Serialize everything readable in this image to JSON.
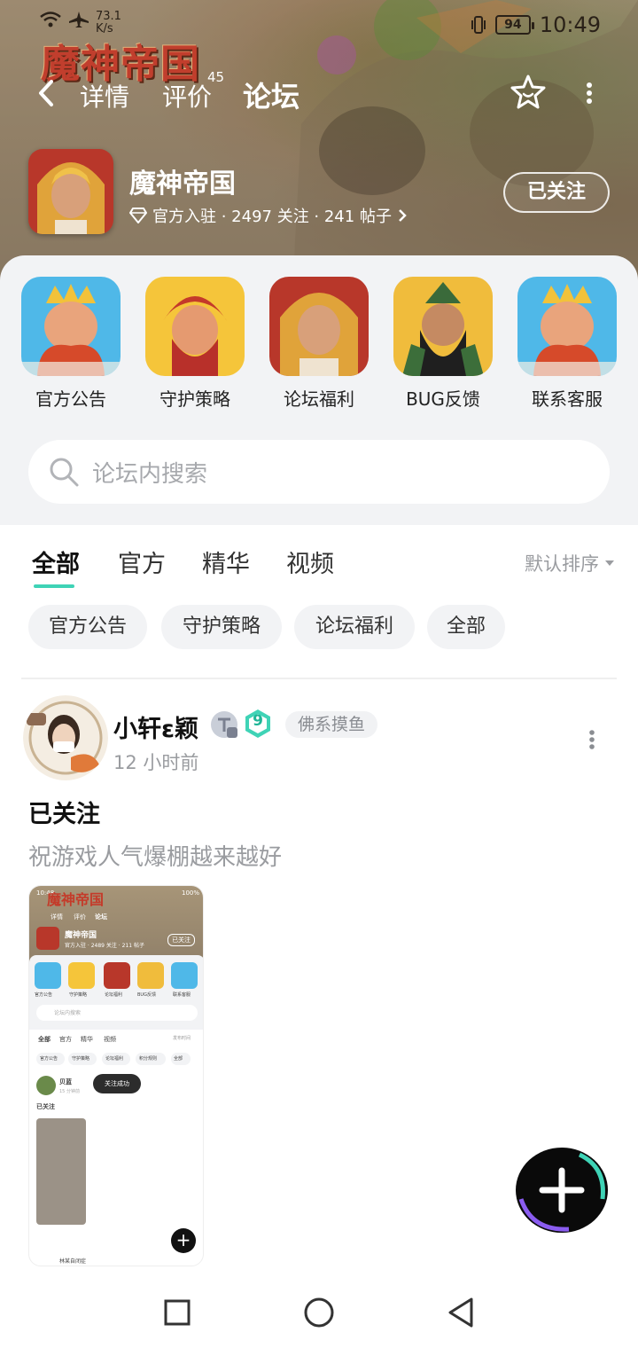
{
  "status_bar": {
    "net_speed_value": "73.1",
    "net_speed_unit": "K/s",
    "battery": "94",
    "time": "10:49"
  },
  "header": {
    "logo_text": "魔神帝国",
    "tabs": [
      {
        "label": "详情",
        "active": false
      },
      {
        "label": "评价",
        "active": false,
        "count": "45"
      },
      {
        "label": "论坛",
        "active": true
      }
    ],
    "accent_color": "#3fd3b6"
  },
  "game": {
    "name": "魔神帝国",
    "meta": "官方入驻 · 2497 关注 · 241 帖子",
    "follow_label": "已关注"
  },
  "shortcuts": [
    {
      "label": "官方公告",
      "icon": "king-portrait-icon"
    },
    {
      "label": "守护策略",
      "icon": "warrior-portrait-icon"
    },
    {
      "label": "论坛福利",
      "icon": "emperor-portrait-icon"
    },
    {
      "label": "BUG反馈",
      "icon": "general-portrait-icon"
    },
    {
      "label": "联系客服",
      "icon": "king-portrait-icon"
    }
  ],
  "search": {
    "placeholder": "论坛内搜索"
  },
  "filter_tabs": [
    {
      "label": "全部",
      "active": true
    },
    {
      "label": "官方",
      "active": false
    },
    {
      "label": "精华",
      "active": false
    },
    {
      "label": "视频",
      "active": false
    }
  ],
  "sort_label": "默认排序",
  "chips": [
    "官方公告",
    "守护策略",
    "论坛福利",
    "全部"
  ],
  "post": {
    "author": "小轩ɛ颖",
    "level": "9",
    "tag": "佛系摸鱼",
    "time": "12 小时前",
    "title": "已关注",
    "body": "祝游戏人气爆棚越来越好",
    "screenshot": {
      "status_time": "10:48",
      "battery": "100%",
      "logo": "魔神帝国",
      "tabs": [
        "详情",
        "评价",
        "论坛"
      ],
      "game_name": "魔神帝国",
      "game_meta": "官方入驻 · 2489 关注 · 211 帖子",
      "follow_label": "已关注",
      "shortcuts": [
        "官方公告",
        "守护策略",
        "论坛福利",
        "BUG反馈",
        "联系客服"
      ],
      "search_placeholder": "论坛内搜索",
      "filter_tabs": [
        "全部",
        "官方",
        "精华",
        "视频"
      ],
      "sort_label": "发布时间",
      "chips": [
        "官方公告",
        "守护策略",
        "论坛福利",
        "积分规则",
        "全部"
      ],
      "post_author": "贝蓝",
      "post_time": "15 分钟前",
      "post_title": "已关注",
      "toast": "关注成功",
      "next_author": "林某自闭症"
    }
  }
}
